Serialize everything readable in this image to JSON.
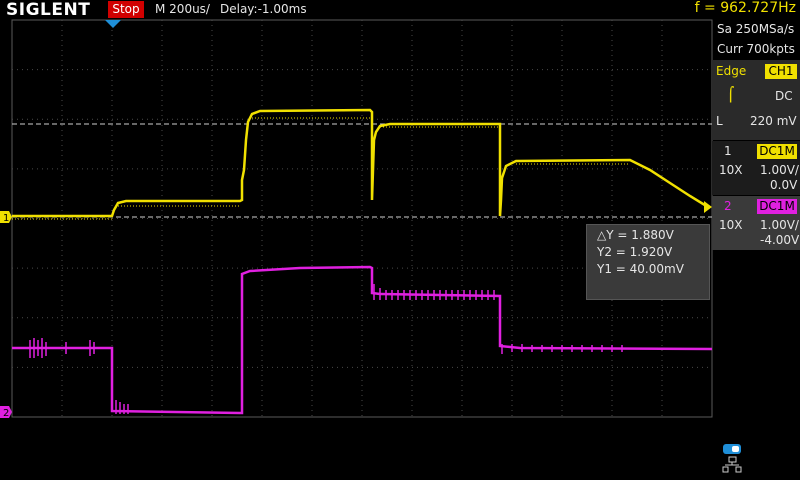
{
  "header": {
    "brand": "SIGLENT",
    "run_state": "Stop",
    "timebase": "M 200us/",
    "delay": "Delay:-1.00ms",
    "frequency": "f = 962.727Hz"
  },
  "acquisition": {
    "sample_rate": "Sa 250MSa/s",
    "memory_depth": "Curr 700kpts"
  },
  "trigger": {
    "mode_label": "Edge",
    "source": "CH1",
    "coupling": "DC",
    "level_label": "L",
    "level": "220 mV"
  },
  "channels": [
    {
      "number": "1",
      "coupling": "DC1M",
      "probe": "10X",
      "scale": "1.00V/",
      "offset": "0.0V",
      "color": "#f0e000"
    },
    {
      "number": "2",
      "coupling": "DC1M",
      "probe": "10X",
      "scale": "1.00V/",
      "offset": "-4.00V",
      "color": "#e020e0"
    }
  ],
  "cursors": {
    "delta_y": "△Y = 1.880V",
    "y2": "Y2 = 1.920V",
    "y1": "Y1 = 40.00mV"
  },
  "markers": {
    "ch1": "1",
    "ch2": "2"
  },
  "colors": {
    "ch1": "#f0e000",
    "ch2": "#e020e0",
    "grid": "#4a4a4a",
    "stop_badge": "#d10000",
    "trigger_marker": "#1f8fd8"
  }
}
